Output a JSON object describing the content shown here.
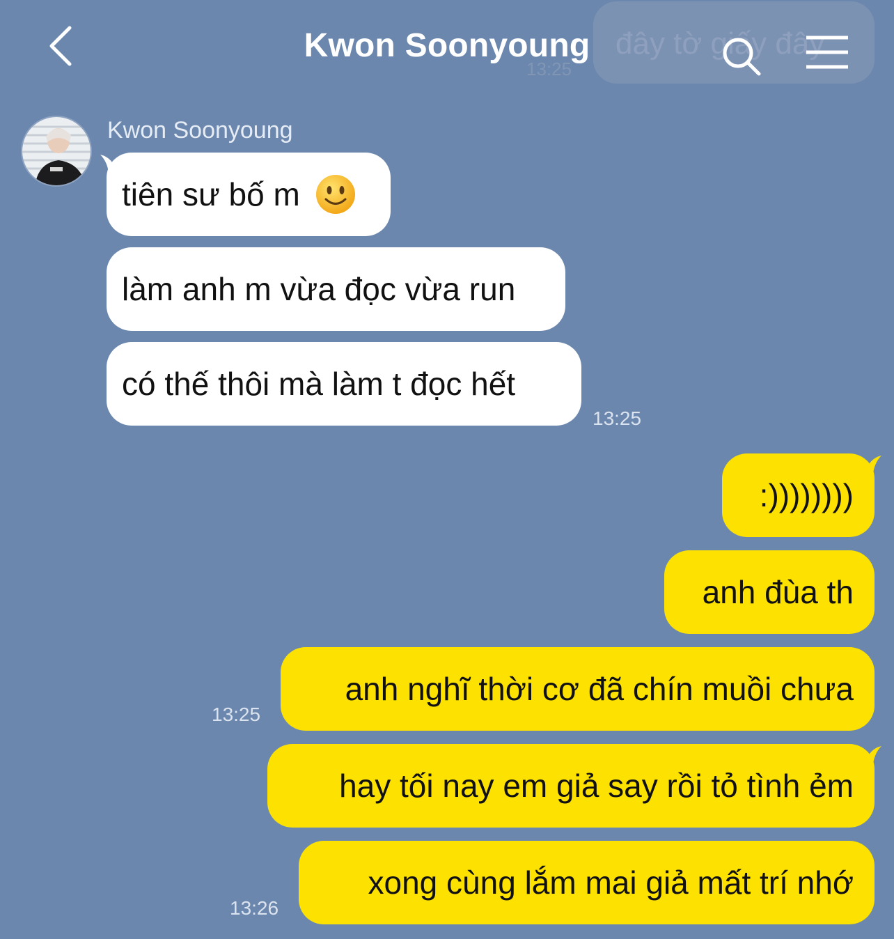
{
  "header": {
    "title": "Kwon Soonyoung",
    "ghost_message": "đây tờ giấy đây",
    "ghost_time": "13:25"
  },
  "sender": {
    "name": "Kwon Soonyoung"
  },
  "messages": [
    {
      "side": "in",
      "text": "tiên sư bố m",
      "emoji": "slightly-smiling-face"
    },
    {
      "side": "in",
      "text": "làm anh m vừa đọc vừa run"
    },
    {
      "side": "in",
      "text": "có thế thôi mà làm t đọc hết",
      "time": "13:25"
    },
    {
      "side": "out",
      "text": ":))))))))"
    },
    {
      "side": "out",
      "text": "anh đùa th"
    },
    {
      "side": "out",
      "text": "anh nghĩ thời cơ đã chín muồi chưa",
      "time": "13:25"
    },
    {
      "side": "out",
      "text": "hay tối nay em giả say rồi tỏ tình ẻm"
    },
    {
      "side": "out",
      "text": "xong cùng lắm mai giả mất trí nhớ",
      "time": "13:26"
    }
  ],
  "colors": {
    "background": "#6b87ae",
    "incoming": "#ffffff",
    "outgoing": "#fde100"
  }
}
